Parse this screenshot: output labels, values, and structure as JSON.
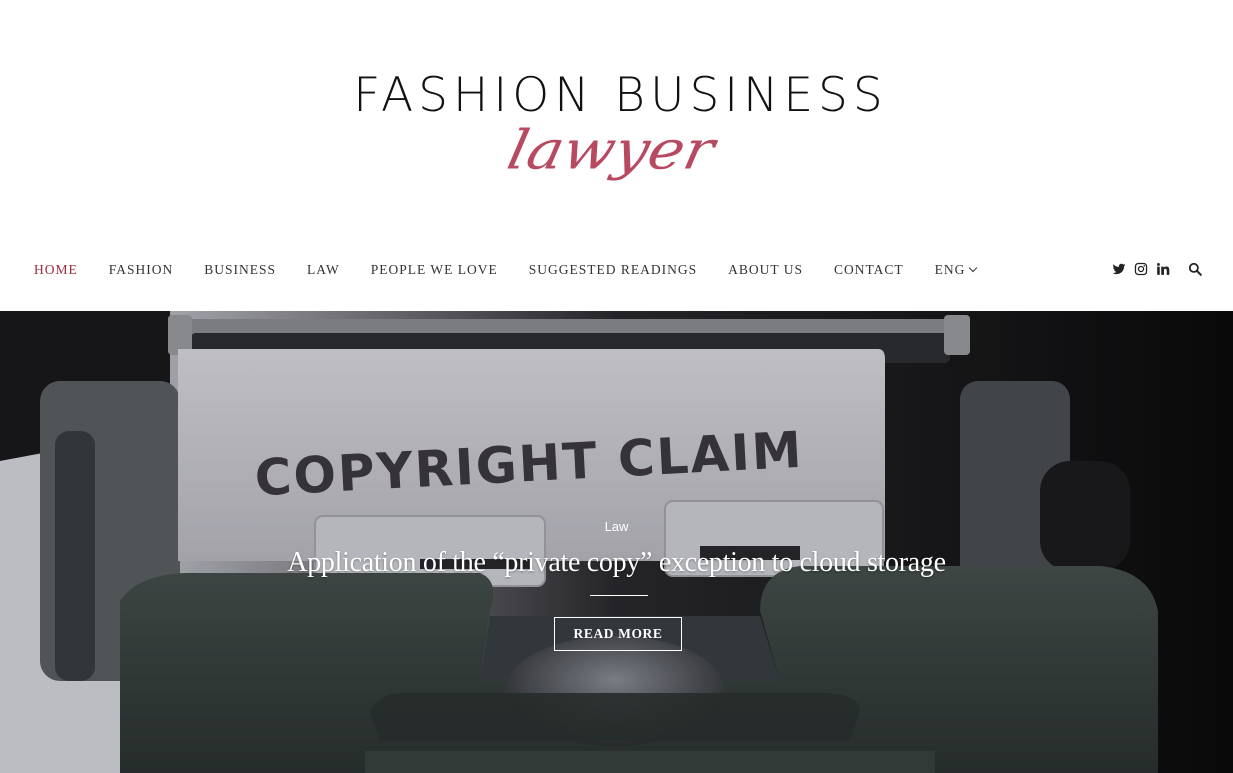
{
  "logo": {
    "title": "FASHION BUSINESS",
    "subtitle": "lawyer"
  },
  "nav": {
    "items": [
      {
        "label": "HOME",
        "active": true
      },
      {
        "label": "FASHION",
        "active": false
      },
      {
        "label": "BUSINESS",
        "active": false
      },
      {
        "label": "LAW",
        "active": false
      },
      {
        "label": "PEOPLE WE LOVE",
        "active": false
      },
      {
        "label": "SUGGESTED READINGS",
        "active": false
      },
      {
        "label": "ABOUT US",
        "active": false
      },
      {
        "label": "CONTACT",
        "active": false
      },
      {
        "label": "ENG",
        "active": false,
        "dropdown": true
      }
    ],
    "icons": [
      "twitter-icon",
      "instagram-icon",
      "linkedin-icon",
      "search-icon"
    ]
  },
  "hero": {
    "paper_text": "COPYRIGHT CLAIM",
    "category": "Law",
    "title": "Application of the “private copy” exception to cloud storage",
    "button": "READ MORE"
  },
  "colors": {
    "accent": "#9e2a3f",
    "text": "#333333",
    "logo_script": "#b0364f"
  }
}
